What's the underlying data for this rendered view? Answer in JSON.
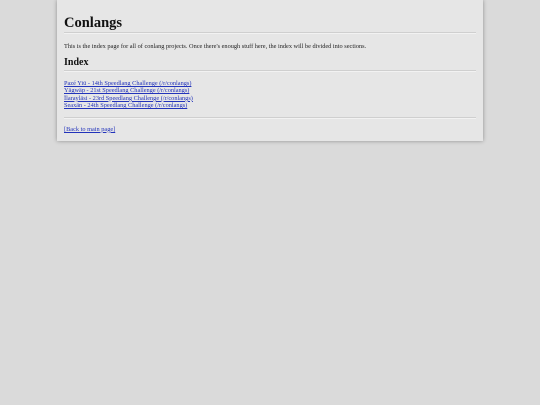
{
  "page": {
    "title": "Conlangs",
    "intro": "This is the index page for all of conlang projects. Once there's enough stuff here, the index will be divided into sections.",
    "index_heading": "Index",
    "index_items": [
      {
        "label": "Pazé Yiü - 14th Speedlang Challenge (/r/conlangs)"
      },
      {
        "label": "Yägwäp - 21st Speedlang Challenge (/r/conlangs)"
      },
      {
        "label": "Ïlarayläsi - 23rd Speedlang Challenge (/r/conlangs)"
      },
      {
        "label": "Seaxän - 24th Speedlang Challenge (/r/conlangs)"
      }
    ],
    "back_link": "[Back to main page]"
  },
  "colors": {
    "background": "#dadada",
    "panel": "#e6e6e6",
    "link": "#2233bb"
  }
}
